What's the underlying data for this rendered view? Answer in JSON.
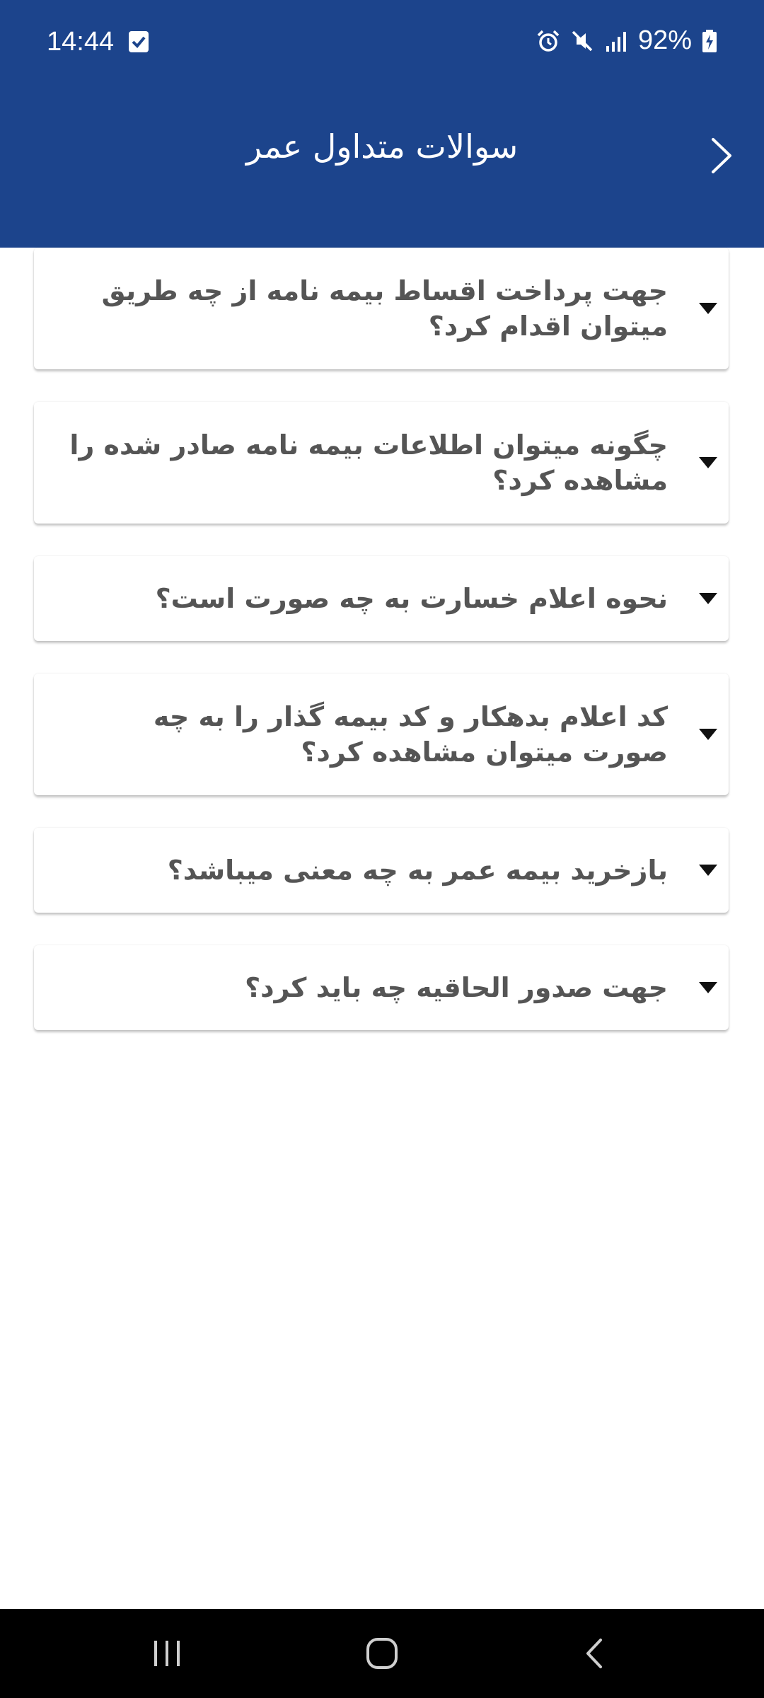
{
  "status": {
    "time": "14:44",
    "battery": "92%"
  },
  "header": {
    "title": "سوالات متداول عمر"
  },
  "faq": [
    {
      "question": "جهت پرداخت اقساط بیمه نامه از چه طریق میتوان اقدام کرد؟"
    },
    {
      "question": "چگونه میتوان اطلاعات بیمه نامه صادر شده را مشاهده کرد؟"
    },
    {
      "question": "نحوه اعلام خسارت به چه صورت است؟"
    },
    {
      "question": "کد اعلام بدهکار و کد بیمه گذار را به چه صورت میتوان مشاهده کرد؟"
    },
    {
      "question": "بازخرید بیمه عمر به چه معنی میباشد؟"
    },
    {
      "question": "جهت صدور الحاقیه چه باید کرد؟"
    }
  ],
  "colors": {
    "appbar": "#1c448c",
    "question_text": "#555555"
  }
}
